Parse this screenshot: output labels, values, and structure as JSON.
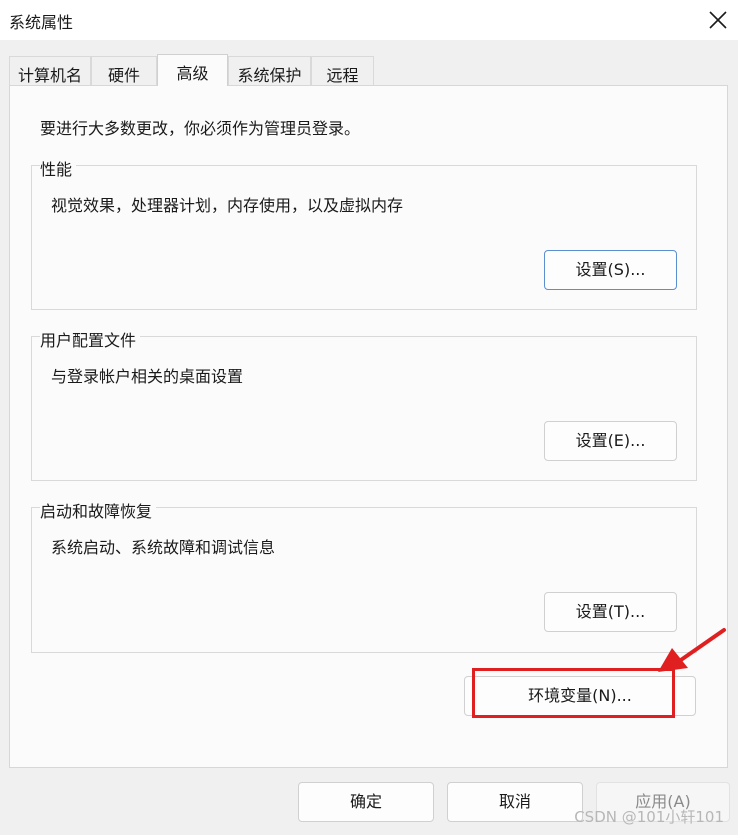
{
  "window": {
    "title": "系统属性"
  },
  "tabs": [
    {
      "label": "计算机名",
      "active": false
    },
    {
      "label": "硬件",
      "active": false
    },
    {
      "label": "高级",
      "active": true
    },
    {
      "label": "系统保护",
      "active": false
    },
    {
      "label": "远程",
      "active": false
    }
  ],
  "intro": "要进行大多数更改，你必须作为管理员登录。",
  "groups": {
    "performance": {
      "legend": "性能",
      "desc": "视觉效果，处理器计划，内存使用，以及虚拟内存",
      "button": "设置(S)..."
    },
    "profiles": {
      "legend": "用户配置文件",
      "desc": "与登录帐户相关的桌面设置",
      "button": "设置(E)..."
    },
    "startup": {
      "legend": "启动和故障恢复",
      "desc": "系统启动、系统故障和调试信息",
      "button": "设置(T)..."
    }
  },
  "env_button": "环境变量(N)...",
  "footer": {
    "ok": "确定",
    "cancel": "取消",
    "apply": "应用(A)"
  },
  "watermark": "CSDN @101小轩101",
  "colors": {
    "annotation": "#e02020",
    "focus_border": "#5b8fd0"
  }
}
